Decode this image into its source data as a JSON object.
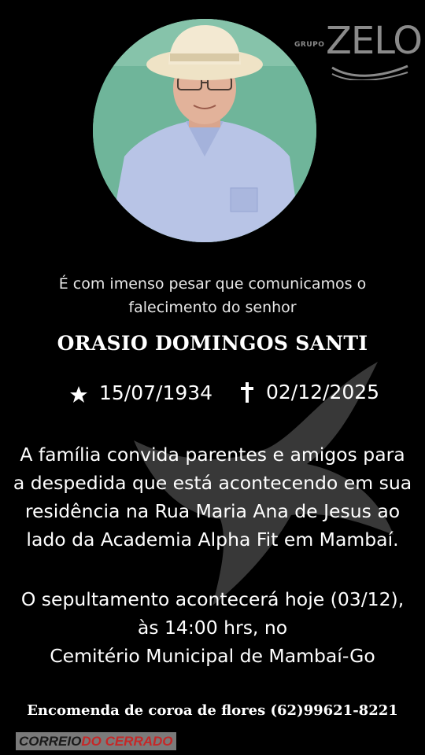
{
  "logo": {
    "small": "GRUPO",
    "brand": "ZELO"
  },
  "intro": {
    "line1": "É com imenso pesar que comunicamos o",
    "line2": "falecimento do senhor"
  },
  "deceased": {
    "name": "ORASIO DOMINGOS SANTI",
    "birth_date": "15/07/1934",
    "death_date": "02/12/2025",
    "birth_icon": "star-icon",
    "death_icon": "cross-icon"
  },
  "message": {
    "lines": [
      "A família convida parentes e amigos para",
      "a despedida que está acontecendo em sua",
      "residência na Rua Maria Ana de Jesus ao",
      "lado da Academia Alpha Fit em Mambaí."
    ]
  },
  "burial": {
    "lines": [
      "O sepultamento acontecerá hoje (03/12),",
      "às 14:00 hrs, no",
      "Cemitério Municipal de Mambaí-Go"
    ]
  },
  "order_text": "Encomenda de coroa de flores (62)99621-8221",
  "watermark": {
    "part1": "CORREIO",
    "part2": "DO CERRADO"
  },
  "colors": {
    "background": "#000000",
    "text": "#ffffff",
    "logo": "#8a8a8a",
    "watermark_red": "#c62828"
  }
}
